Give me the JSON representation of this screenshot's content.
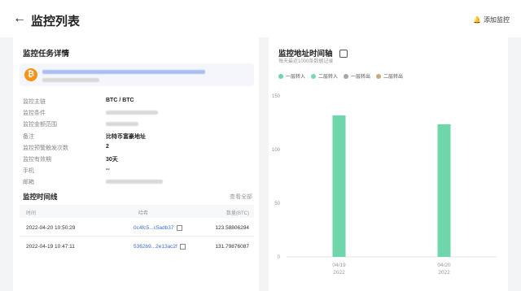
{
  "header": {
    "back_icon": "arrow-left-icon",
    "title": "监控列表",
    "add_label": "添加监控",
    "add_icon": "bell-plus-icon"
  },
  "task": {
    "title": "监控任务详情",
    "coin_symbol": "₿",
    "fields": [
      {
        "label": "监控主链",
        "value": "BTC / BTC"
      },
      {
        "label": "监控条件",
        "value": ""
      },
      {
        "label": "监控金额范围",
        "value": ""
      },
      {
        "label": "备注",
        "value": "比特币富豪地址"
      },
      {
        "label": "监控预警触发次数",
        "value": "2"
      },
      {
        "label": "监控有效期",
        "value": "30天"
      },
      {
        "label": "手机",
        "value": "--"
      },
      {
        "label": "邮箱",
        "value": ""
      }
    ]
  },
  "timeline": {
    "title": "监控时间线",
    "see_all": "查看全部",
    "columns": [
      "时间",
      "哈希",
      "数量(BTC)"
    ],
    "rows": [
      {
        "time": "2022-04-20 10:50:29",
        "hash": "0c4fc5...c5adb37",
        "amount": "123.58806294"
      },
      {
        "time": "2022-04-19 10:47:11",
        "hash": "5362b9...2e13ac2f",
        "amount": "131.79876087"
      }
    ]
  },
  "chart_panel": {
    "title": "监控地址时间轴",
    "subtitle": "每天最近1000条数据记录",
    "legend": [
      {
        "name": "一层转入",
        "color": "#6fd6ac"
      },
      {
        "name": "二层转入",
        "color": "#7bd9b0"
      },
      {
        "name": "一层转出",
        "color": "#a6a6a6"
      },
      {
        "name": "二层转出",
        "color": "#c8a978"
      }
    ]
  },
  "chart_data": {
    "type": "bar",
    "categories": [
      "04/19\n2022",
      "04/20\n2022"
    ],
    "x_tick_top": [
      "04/19",
      "04/20"
    ],
    "x_tick_bottom": [
      "2022",
      "2022"
    ],
    "values": [
      131.8,
      123.6
    ],
    "yticks": [
      "0",
      "50",
      "100",
      "150"
    ],
    "ylim": [
      0,
      150
    ],
    "bar_color": "#6fd6ac"
  }
}
